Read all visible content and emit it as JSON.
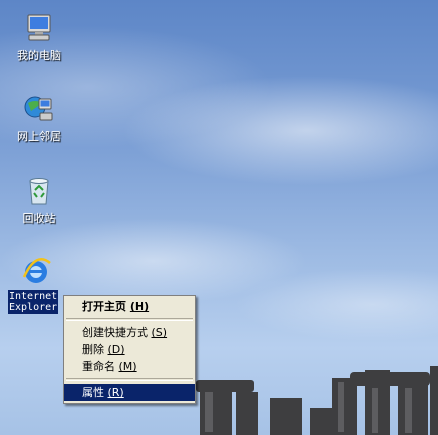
{
  "desktop": {
    "icons": [
      {
        "label": "我的电脑",
        "icon": "my-computer-icon"
      },
      {
        "label": "网上邻居",
        "icon": "network-places-icon"
      },
      {
        "label": "回收站",
        "icon": "recycle-bin-icon"
      },
      {
        "label_line1": "Internet",
        "label_line2": "Explorer",
        "icon": "internet-explorer-icon"
      }
    ]
  },
  "context_menu": {
    "items": [
      {
        "text": "打开主页",
        "key": "(H)",
        "bold": true
      },
      {
        "separator": true
      },
      {
        "text": "创建快捷方式",
        "key": "(S)"
      },
      {
        "text": "删除",
        "key": "(D)"
      },
      {
        "text": "重命名",
        "key": "(M)"
      },
      {
        "separator": true
      },
      {
        "text": "属性",
        "key": "(R)",
        "highlighted": true
      }
    ]
  },
  "colors": {
    "selection": "#0a246a",
    "menu_bg": "#ece9d8"
  }
}
